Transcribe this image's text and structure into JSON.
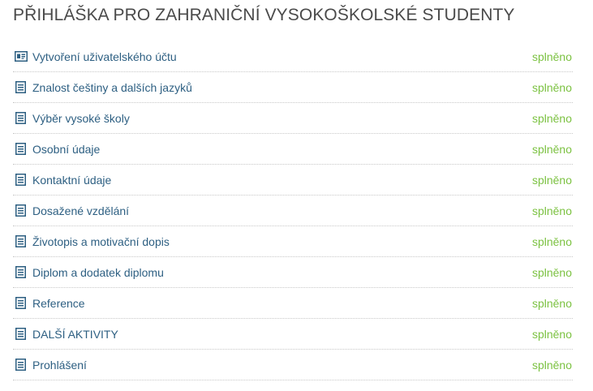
{
  "header": {
    "title": "PŘIHLÁŠKA PRO ZAHRANIČNÍ VYSOKOŠKOLSKÉ STUDENTY"
  },
  "colors": {
    "link": "#2d5f82",
    "status_done": "#7cc242",
    "title": "#4a4a4a"
  },
  "steps": [
    {
      "label": "Vytvoření uživatelského účtu",
      "status": "splněno",
      "icon": "id-card-icon"
    },
    {
      "label": "Znalost češtiny a dalších jazyků",
      "status": "splněno",
      "icon": "document-icon"
    },
    {
      "label": "Výběr vysoké školy",
      "status": "splněno",
      "icon": "document-icon"
    },
    {
      "label": "Osobní údaje",
      "status": "splněno",
      "icon": "document-icon"
    },
    {
      "label": "Kontaktní údaje",
      "status": "splněno",
      "icon": "document-icon"
    },
    {
      "label": "Dosažené vzdělání",
      "status": "splněno",
      "icon": "document-icon"
    },
    {
      "label": "Životopis a motivační dopis",
      "status": "splněno",
      "icon": "document-icon"
    },
    {
      "label": "Diplom a dodatek diplomu",
      "status": "splněno",
      "icon": "document-icon"
    },
    {
      "label": "Reference",
      "status": "splněno",
      "icon": "document-icon"
    },
    {
      "label": "DALŠÍ AKTIVITY",
      "status": "splněno",
      "icon": "document-icon"
    },
    {
      "label": "Prohlášení",
      "status": "splněno",
      "icon": "document-icon"
    }
  ]
}
